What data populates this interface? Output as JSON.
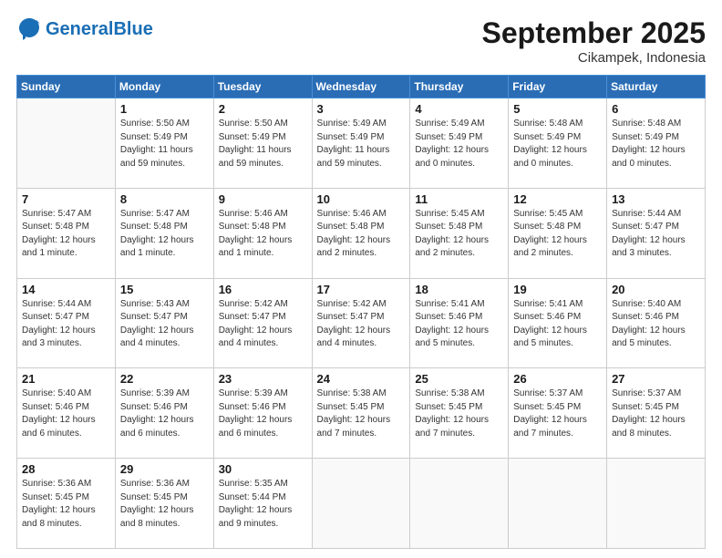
{
  "header": {
    "logo_line1": "General",
    "logo_line2": "Blue",
    "month_title": "September 2025",
    "location": "Cikampek, Indonesia"
  },
  "weekdays": [
    "Sunday",
    "Monday",
    "Tuesday",
    "Wednesday",
    "Thursday",
    "Friday",
    "Saturday"
  ],
  "weeks": [
    [
      {
        "day": "",
        "info": ""
      },
      {
        "day": "1",
        "info": "Sunrise: 5:50 AM\nSunset: 5:49 PM\nDaylight: 11 hours\nand 59 minutes."
      },
      {
        "day": "2",
        "info": "Sunrise: 5:50 AM\nSunset: 5:49 PM\nDaylight: 11 hours\nand 59 minutes."
      },
      {
        "day": "3",
        "info": "Sunrise: 5:49 AM\nSunset: 5:49 PM\nDaylight: 11 hours\nand 59 minutes."
      },
      {
        "day": "4",
        "info": "Sunrise: 5:49 AM\nSunset: 5:49 PM\nDaylight: 12 hours\nand 0 minutes."
      },
      {
        "day": "5",
        "info": "Sunrise: 5:48 AM\nSunset: 5:49 PM\nDaylight: 12 hours\nand 0 minutes."
      },
      {
        "day": "6",
        "info": "Sunrise: 5:48 AM\nSunset: 5:49 PM\nDaylight: 12 hours\nand 0 minutes."
      }
    ],
    [
      {
        "day": "7",
        "info": "Sunrise: 5:47 AM\nSunset: 5:48 PM\nDaylight: 12 hours\nand 1 minute."
      },
      {
        "day": "8",
        "info": "Sunrise: 5:47 AM\nSunset: 5:48 PM\nDaylight: 12 hours\nand 1 minute."
      },
      {
        "day": "9",
        "info": "Sunrise: 5:46 AM\nSunset: 5:48 PM\nDaylight: 12 hours\nand 1 minute."
      },
      {
        "day": "10",
        "info": "Sunrise: 5:46 AM\nSunset: 5:48 PM\nDaylight: 12 hours\nand 2 minutes."
      },
      {
        "day": "11",
        "info": "Sunrise: 5:45 AM\nSunset: 5:48 PM\nDaylight: 12 hours\nand 2 minutes."
      },
      {
        "day": "12",
        "info": "Sunrise: 5:45 AM\nSunset: 5:48 PM\nDaylight: 12 hours\nand 2 minutes."
      },
      {
        "day": "13",
        "info": "Sunrise: 5:44 AM\nSunset: 5:47 PM\nDaylight: 12 hours\nand 3 minutes."
      }
    ],
    [
      {
        "day": "14",
        "info": "Sunrise: 5:44 AM\nSunset: 5:47 PM\nDaylight: 12 hours\nand 3 minutes."
      },
      {
        "day": "15",
        "info": "Sunrise: 5:43 AM\nSunset: 5:47 PM\nDaylight: 12 hours\nand 4 minutes."
      },
      {
        "day": "16",
        "info": "Sunrise: 5:42 AM\nSunset: 5:47 PM\nDaylight: 12 hours\nand 4 minutes."
      },
      {
        "day": "17",
        "info": "Sunrise: 5:42 AM\nSunset: 5:47 PM\nDaylight: 12 hours\nand 4 minutes."
      },
      {
        "day": "18",
        "info": "Sunrise: 5:41 AM\nSunset: 5:46 PM\nDaylight: 12 hours\nand 5 minutes."
      },
      {
        "day": "19",
        "info": "Sunrise: 5:41 AM\nSunset: 5:46 PM\nDaylight: 12 hours\nand 5 minutes."
      },
      {
        "day": "20",
        "info": "Sunrise: 5:40 AM\nSunset: 5:46 PM\nDaylight: 12 hours\nand 5 minutes."
      }
    ],
    [
      {
        "day": "21",
        "info": "Sunrise: 5:40 AM\nSunset: 5:46 PM\nDaylight: 12 hours\nand 6 minutes."
      },
      {
        "day": "22",
        "info": "Sunrise: 5:39 AM\nSunset: 5:46 PM\nDaylight: 12 hours\nand 6 minutes."
      },
      {
        "day": "23",
        "info": "Sunrise: 5:39 AM\nSunset: 5:46 PM\nDaylight: 12 hours\nand 6 minutes."
      },
      {
        "day": "24",
        "info": "Sunrise: 5:38 AM\nSunset: 5:45 PM\nDaylight: 12 hours\nand 7 minutes."
      },
      {
        "day": "25",
        "info": "Sunrise: 5:38 AM\nSunset: 5:45 PM\nDaylight: 12 hours\nand 7 minutes."
      },
      {
        "day": "26",
        "info": "Sunrise: 5:37 AM\nSunset: 5:45 PM\nDaylight: 12 hours\nand 7 minutes."
      },
      {
        "day": "27",
        "info": "Sunrise: 5:37 AM\nSunset: 5:45 PM\nDaylight: 12 hours\nand 8 minutes."
      }
    ],
    [
      {
        "day": "28",
        "info": "Sunrise: 5:36 AM\nSunset: 5:45 PM\nDaylight: 12 hours\nand 8 minutes."
      },
      {
        "day": "29",
        "info": "Sunrise: 5:36 AM\nSunset: 5:45 PM\nDaylight: 12 hours\nand 8 minutes."
      },
      {
        "day": "30",
        "info": "Sunrise: 5:35 AM\nSunset: 5:44 PM\nDaylight: 12 hours\nand 9 minutes."
      },
      {
        "day": "",
        "info": ""
      },
      {
        "day": "",
        "info": ""
      },
      {
        "day": "",
        "info": ""
      },
      {
        "day": "",
        "info": ""
      }
    ]
  ]
}
